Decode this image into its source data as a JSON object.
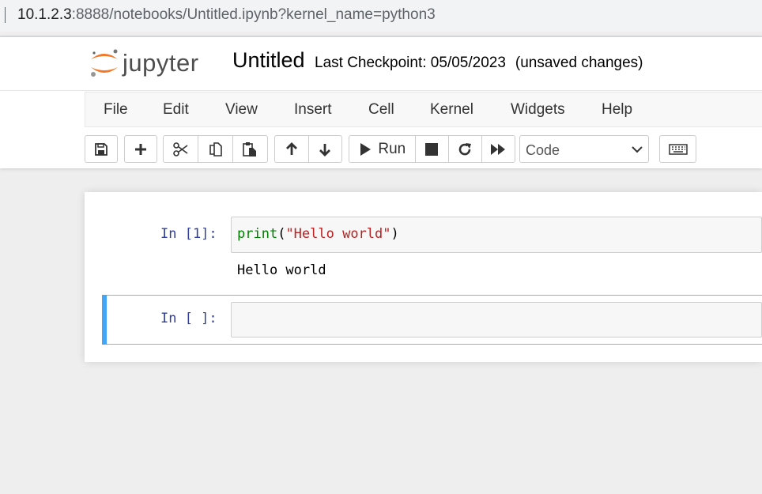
{
  "browser": {
    "url_host": "10.1.2.3",
    "url_rest": ":8888/notebooks/Untitled.ipynb?kernel_name=python3"
  },
  "header": {
    "logo_text": "jupyter",
    "notebook_title": "Untitled",
    "checkpoint": "Last Checkpoint: 05/05/2023",
    "unsaved": "(unsaved changes)"
  },
  "menu": {
    "items": [
      "File",
      "Edit",
      "View",
      "Insert",
      "Cell",
      "Kernel",
      "Widgets",
      "Help"
    ]
  },
  "toolbar": {
    "run_label": "Run",
    "cell_type": "Code",
    "cell_type_options": [
      "Code"
    ],
    "icons": [
      "save-icon",
      "plus-icon",
      "scissors-icon",
      "copy-icon",
      "paste-icon",
      "arrow-up-icon",
      "arrow-down-icon",
      "play-icon",
      "stop-icon",
      "restart-icon",
      "fast-forward-icon",
      "chevron-down-icon",
      "keyboard-icon"
    ]
  },
  "cells": [
    {
      "prompt": "In [1]:",
      "code_func": "print",
      "code_open": "(",
      "code_string": "\"Hello world\"",
      "code_close": ")",
      "output": "Hello world"
    },
    {
      "prompt": "In [ ]:",
      "code": ""
    }
  ],
  "colors": {
    "accent": "#42a5f5",
    "prompt": "#303f9f",
    "keyword": "#008000",
    "string": "#ba2121",
    "logo_orange": "#f37726"
  }
}
